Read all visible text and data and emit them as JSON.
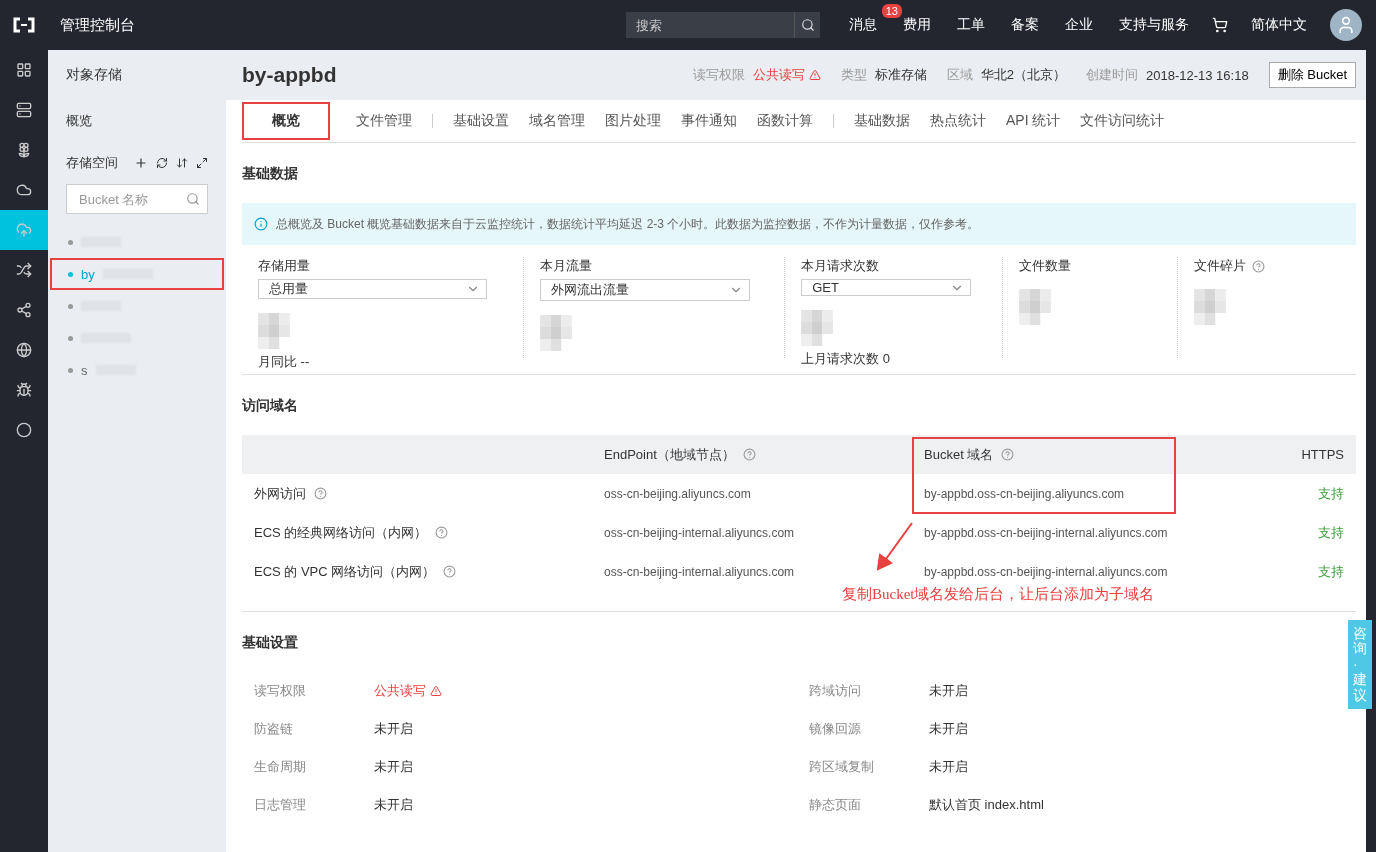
{
  "topbar": {
    "title": "管理控制台",
    "search_placeholder": "搜索",
    "nav": [
      {
        "label": "消息",
        "badge": "13"
      },
      {
        "label": "费用"
      },
      {
        "label": "工单"
      },
      {
        "label": "备案"
      },
      {
        "label": "企业"
      },
      {
        "label": "支持与服务"
      },
      {
        "kind": "cart"
      },
      {
        "label": "简体中文"
      }
    ]
  },
  "rail": [
    {
      "selected": false
    },
    {
      "selected": false
    },
    {
      "selected": false
    },
    {
      "selected": false
    },
    {
      "selected": true
    },
    {
      "selected": false
    },
    {
      "selected": false
    },
    {
      "selected": false
    },
    {
      "selected": false
    },
    {
      "selected": false
    }
  ],
  "sidebar": {
    "title": "对象存储",
    "overview": "概览",
    "storage_label": "存储空间",
    "search_placeholder": "Bucket 名称",
    "buckets": [
      {
        "selected": false,
        "highlighted": false
      },
      {
        "label": "by",
        "selected": true,
        "highlighted": true
      },
      {
        "selected": false,
        "highlighted": false
      },
      {
        "selected": false,
        "highlighted": false
      },
      {
        "label": "s",
        "selected": false,
        "highlighted": false
      }
    ]
  },
  "header": {
    "name": "by-appbd",
    "meta": [
      {
        "label": "读写权限",
        "value": "公共读写",
        "warning": true
      },
      {
        "label": "类型",
        "value": "标准存储",
        "warning": false
      },
      {
        "label": "区域",
        "value": "华北2（北京）",
        "warning": false
      },
      {
        "label": "创建时间",
        "value": "2018-12-13 16:18",
        "warning": false
      }
    ],
    "delete_button": "删除 Bucket"
  },
  "tab_groups": [
    [
      {
        "label": "概览",
        "selected": true,
        "highlighted": true
      },
      {
        "label": "文件管理",
        "selected": false,
        "highlighted": false
      }
    ],
    [
      {
        "label": "基础设置",
        "selected": false,
        "highlighted": false
      },
      {
        "label": "域名管理",
        "selected": false,
        "highlighted": false
      },
      {
        "label": "图片处理",
        "selected": false,
        "highlighted": false
      },
      {
        "label": "事件通知",
        "selected": false,
        "highlighted": false
      },
      {
        "label": "函数计算",
        "selected": false,
        "highlighted": false
      }
    ],
    [
      {
        "label": "基础数据",
        "selected": false,
        "highlighted": false
      },
      {
        "label": "热点统计",
        "selected": false,
        "highlighted": false
      },
      {
        "label": "API 统计",
        "selected": false,
        "highlighted": false
      },
      {
        "label": "文件访问统计",
        "selected": false,
        "highlighted": false
      }
    ]
  ],
  "basic_data": {
    "title": "基础数据",
    "notice": "总概览及 Bucket 概览基础数据来自于云监控统计，数据统计平均延迟 2-3 个小时。此数据为监控数据，不作为计量数据，仅作参考。",
    "stats": [
      {
        "label": "存储用量",
        "select": "总用量",
        "footer": "月同比 --"
      },
      {
        "label": "本月流量",
        "select": "外网流出流量"
      },
      {
        "label": "本月请求次数",
        "select": "GET",
        "footer": "上月请求次数 0"
      },
      {
        "label": "文件数量"
      },
      {
        "label": "文件碎片",
        "help": true
      }
    ]
  },
  "domains": {
    "title": "访问域名",
    "columns": [
      {
        "label": "EndPoint（地域节点）",
        "help": true,
        "highlighted": false
      },
      {
        "label": "Bucket 域名",
        "help": true,
        "highlighted": true
      },
      {
        "label": "HTTPS",
        "help": false,
        "highlighted": false
      }
    ],
    "rows": [
      {
        "label": "外网访问",
        "endpoint": "oss-cn-beijing.aliyuncs.com",
        "bucket_domain": "by-appbd.oss-cn-beijing.aliyuncs.com",
        "https": "支持"
      },
      {
        "label": "ECS 的经典网络访问（内网）",
        "endpoint": "oss-cn-beijing-internal.aliyuncs.com",
        "bucket_domain": "by-appbd.oss-cn-beijing-internal.aliyuncs.com",
        "https": "支持"
      },
      {
        "label": "ECS 的 VPC 网络访问（内网）",
        "endpoint": "oss-cn-beijing-internal.aliyuncs.com",
        "bucket_domain": "by-appbd.oss-cn-beijing-internal.aliyuncs.com",
        "https": "支持"
      }
    ],
    "annotation": "复制Bucket域名发给后台，让后台添加为子域名"
  },
  "settings": {
    "title": "基础设置",
    "items": [
      {
        "label": "读写权限",
        "value": "公共读写",
        "warning": true
      },
      {
        "label": "跨域访问",
        "value": "未开启",
        "warning": false
      },
      {
        "label": "防盗链",
        "value": "未开启",
        "warning": false
      },
      {
        "label": "镜像回源",
        "value": "未开启",
        "warning": false
      },
      {
        "label": "生命周期",
        "value": "未开启",
        "warning": false
      },
      {
        "label": "跨区域复制",
        "value": "未开启",
        "warning": false
      },
      {
        "label": "日志管理",
        "value": "未开启",
        "warning": false
      },
      {
        "label": "静态页面",
        "value": "默认首页 index.html",
        "warning": false
      }
    ]
  },
  "feedback": "咨询·建议"
}
